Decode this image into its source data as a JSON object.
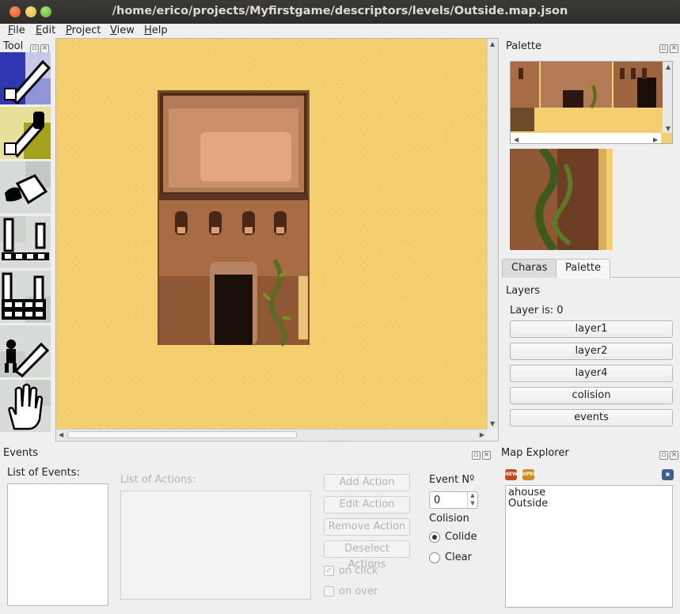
{
  "window": {
    "title": "/home/erico/projects/Myfirstgame/descriptors/levels/Outside.map.json"
  },
  "menu": [
    {
      "label": "File",
      "mnemonic": "F",
      "rest": "ile"
    },
    {
      "label": "Edit",
      "mnemonic": "E",
      "rest": "dit"
    },
    {
      "label": "Project",
      "mnemonic": "P",
      "rest": "roject"
    },
    {
      "label": "View",
      "mnemonic": "V",
      "rest": "iew"
    },
    {
      "label": "Help",
      "mnemonic": "H",
      "rest": "elp"
    }
  ],
  "tool_dock": {
    "title": "Tool",
    "tools": [
      "pencil-tool",
      "eyedropper-tool",
      "fill-bucket-tool",
      "line-tool",
      "rectangle-tool",
      "character-placer-tool",
      "hand-pan-tool"
    ]
  },
  "palette_dock": {
    "title": "Palette"
  },
  "tabs": [
    {
      "label": "Charas",
      "active": false
    },
    {
      "label": "Palette",
      "active": true
    }
  ],
  "layers_dock": {
    "title": "Layers",
    "status": "Layer is: 0",
    "layers": [
      "layer1",
      "layer2",
      "layer4",
      "colision",
      "events"
    ]
  },
  "events_dock": {
    "title": "Events",
    "list_events_label": "List of Events:",
    "list_actions_label": "List of Actions:",
    "buttons": [
      "Add Action",
      "Edit Action",
      "Remove Action",
      "Deselect Actions"
    ],
    "on_click_label": "on click",
    "on_over_label": "on over",
    "event_no_label": "Event Nº",
    "event_no_value": "0",
    "colision_label": "Colision",
    "colide_label": "Colide",
    "clear_label": "Clear",
    "colision_selected": "Colide"
  },
  "map_explorer": {
    "title": "Map Explorer",
    "items": [
      "ahouse",
      "Outside"
    ],
    "icons": [
      "new-map-icon",
      "open-map-icon",
      "trash-icon"
    ]
  },
  "colors": {
    "titlebar": "#2e2d2a",
    "sand": "#f3cf6f",
    "wall": "#a86c44",
    "accent": "#6b8f3a"
  }
}
